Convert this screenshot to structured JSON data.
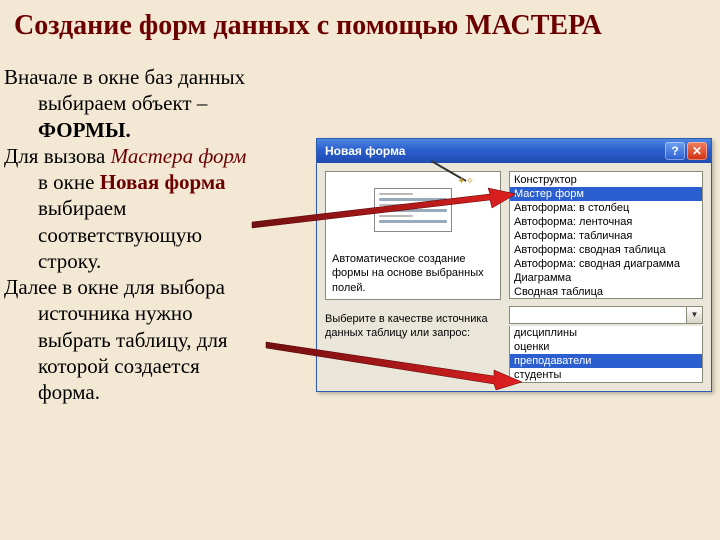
{
  "slide": {
    "title": "Создание форм данных с помощью МАСТЕРА",
    "p1a": "Вначале в окне баз данных",
    "p1b": "выбираем объект –",
    "p1c": "ФОРМЫ.",
    "p2a": "Для вызова ",
    "p2b": "Мастера форм",
    "p2c": "в окне ",
    "p2d": "Новая форма",
    "p2e": "выбираем",
    "p2f": "соответствующую",
    "p2g": "строку.",
    "p3a": "Далее в окне для выбора",
    "p3b": "источника нужно",
    "p3c": "выбрать таблицу, для",
    "p3d": "которой создается",
    "p3e": "форма."
  },
  "dialog": {
    "title": "Новая форма",
    "help": "?",
    "close": "✕",
    "preview_desc": "Автоматическое создание формы на основе выбранных полей.",
    "types": [
      "Конструктор",
      "Мастер форм",
      "Автоформа: в столбец",
      "Автоформа: ленточная",
      "Автоформа: табличная",
      "Автоформа:  сводная таблица",
      "Автоформа:  сводная диаграмма",
      "Диаграмма",
      "Сводная таблица"
    ],
    "types_selected_index": 1,
    "source_label": "Выберите в качестве источника данных таблицу или запрос:",
    "combo_value": "",
    "sources": [
      "дисциплины",
      "оценки",
      "преподаватели",
      "студенты"
    ],
    "sources_selected_index": 2
  }
}
